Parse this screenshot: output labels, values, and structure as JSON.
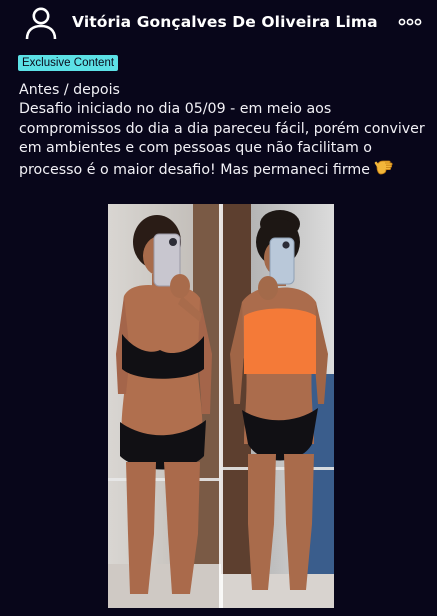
{
  "post": {
    "author": "Vitória Gonçalves De Oliveira Lima",
    "badge": "Exclusive Content",
    "title_line": "Antes / depois",
    "body": "Desafio iniciado no dia 05/09 - em meio aos compromissos do dia a dia pareceu fácil, porém conviver em ambientes e com pessoas que não facilitam o processo é o maior desafio! Mas permaneci firme"
  },
  "icons": {
    "avatar": "user-outline-icon",
    "menu": "more-horizontal-icon",
    "emoji": "hand-emoji-icon"
  },
  "colors": {
    "background": "#08061a",
    "badge": "#5ce1e6",
    "text": "#f2f1f6"
  }
}
